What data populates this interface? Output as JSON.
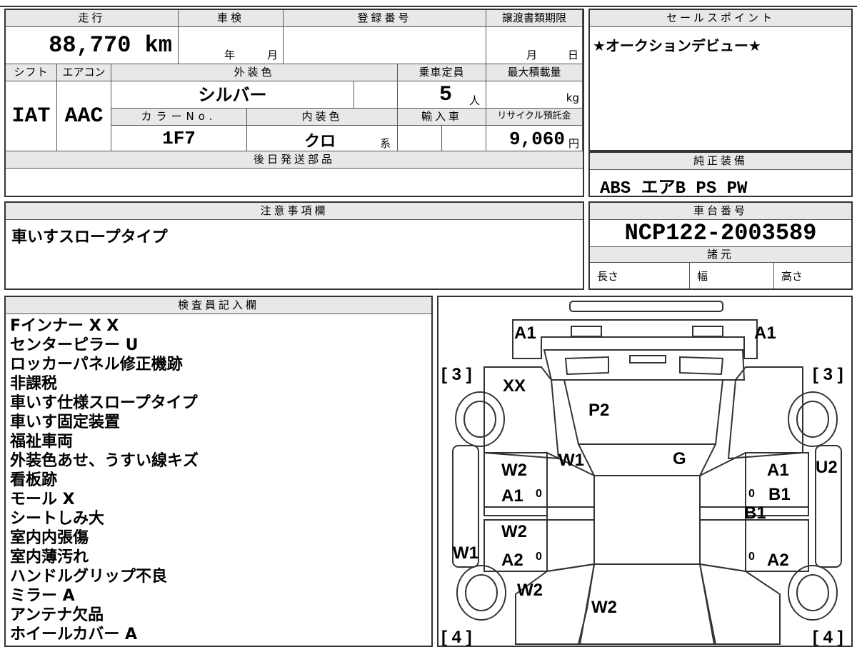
{
  "main_info": {
    "mileage_label": "走行",
    "mileage": "88,770 km",
    "shaken_label": "車検",
    "year_unit": "年",
    "month_unit": "月",
    "reg_label": "登録番号",
    "transfer_label": "譲渡書類期限",
    "transfer_month": "月",
    "transfer_day": "日",
    "shift_label": "シフト",
    "shift": "IAT",
    "ac_label": "エアコン",
    "ac": "AAC",
    "ext_color_label": "外装色",
    "ext_color": "シルバー",
    "capacity_label": "乗車定員",
    "capacity": "5",
    "capacity_unit": "人",
    "max_load_label": "最大積載量",
    "max_load_unit": "kg",
    "color_no_label": "カラーNo.",
    "color_no": "1F7",
    "int_color_label": "内装色",
    "int_color": "クロ",
    "int_color_suffix": "系",
    "import_label": "輸入車",
    "recycle_label": "リサイクル預託金",
    "recycle": "9,060",
    "recycle_unit": "円",
    "later_parts_label": "後日発送部品"
  },
  "sales_point": {
    "label": "セールスポイント",
    "text": "★オークションデビュー★"
  },
  "genuine": {
    "label": "純正装備",
    "text": "ABS エアB PS PW"
  },
  "caution": {
    "label": "注意事項欄",
    "text": "車いすスロープタイプ"
  },
  "chassis": {
    "label": "車台番号",
    "number": "NCP122-2003589",
    "spec_label": "諸元",
    "length_label": "長さ",
    "width_label": "幅",
    "height_label": "高さ"
  },
  "inspector": {
    "label": "検査員記入欄",
    "notes": [
      "Fインナー X X",
      "センターピラー U",
      "ロッカーパネル修正機跡",
      "非課税",
      "車いす仕様スロープタイプ",
      "車いす固定装置",
      "福祉車両",
      "外装色あせ、うすい線キズ",
      "看板跡",
      "モール X",
      "シートしみ大",
      "室内内張傷",
      "室内薄汚れ",
      "ハンドルグリップ不良",
      "ミラー A",
      "アンテナ欠品",
      "ホイールカバー A"
    ]
  },
  "diagram": {
    "marks": {
      "a1_front_left": "A1",
      "a1_front_right": "A1",
      "tire_fl": "[ 3 ]",
      "tire_fr": "[ 3 ]",
      "tire_rl": "[ 4 ]",
      "tire_rr": "[ 4 ]",
      "xx": "XX",
      "p2": "P2",
      "w1_pillar": "W1",
      "g": "G",
      "w2_fl": "W2",
      "a1_fl": "A1",
      "a1_fr": "A1",
      "b1_fr": "B1",
      "b1_mid": "B1",
      "u2": "U2",
      "w2_rl": "W2",
      "a2_rl": "A2",
      "a2_rr": "A2",
      "w1_side": "W1",
      "w2_rear_side": "W2",
      "w2_rear": "W2",
      "zero1": "0",
      "zero2": "0",
      "zero3": "0",
      "zero4": "0"
    }
  }
}
